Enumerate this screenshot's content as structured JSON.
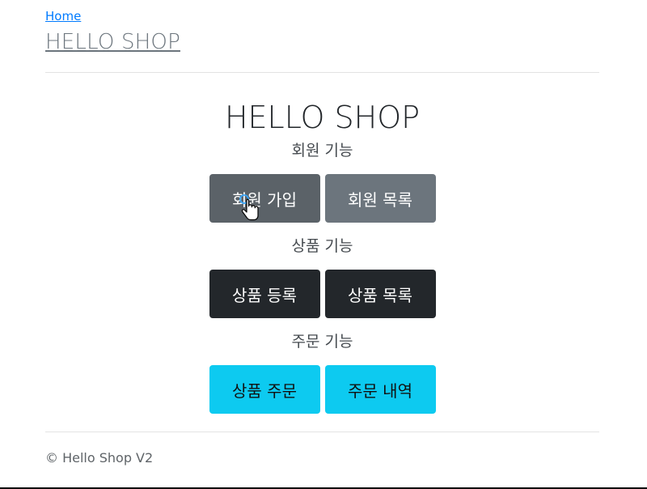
{
  "header": {
    "home_link": "Home",
    "shop_title": "HELLO SHOP"
  },
  "main": {
    "title": "HELLO SHOP",
    "sections": [
      {
        "label": "회원 기능",
        "buttons": [
          "회원 가입",
          "회원 목록"
        ]
      },
      {
        "label": "상품 기능",
        "buttons": [
          "상품 등록",
          "상품 목록"
        ]
      },
      {
        "label": "주문 기능",
        "buttons": [
          "상품 주문",
          "주문 내역"
        ]
      }
    ]
  },
  "footer": {
    "text": "© Hello Shop V2"
  },
  "colors": {
    "link": "#007bff",
    "secondary": "#6c757d",
    "dark": "#23272b",
    "info": "#0dcaf0"
  }
}
